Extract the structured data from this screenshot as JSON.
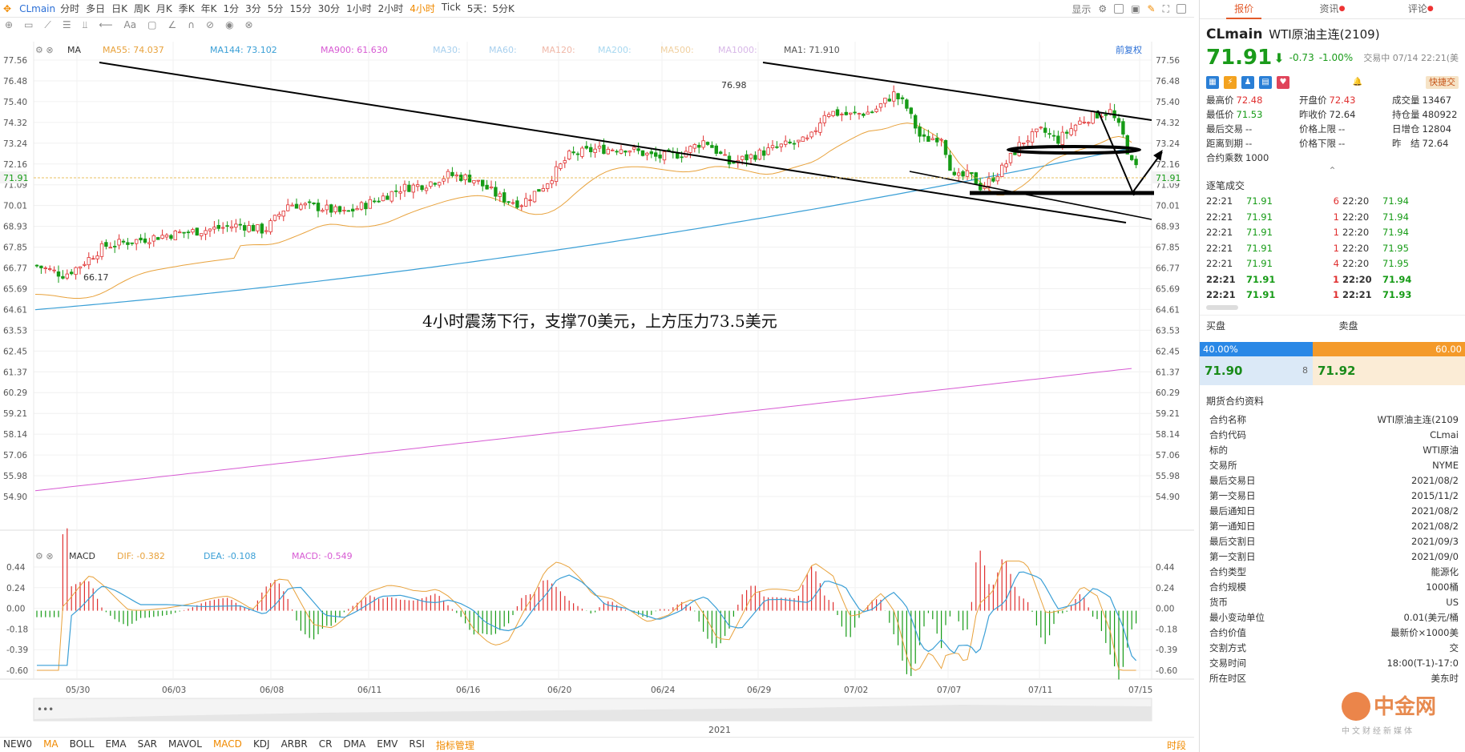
{
  "toolbar": {
    "symbol": "CLmain",
    "periods": [
      "分时",
      "多日",
      "日K",
      "周K",
      "月K",
      "季K",
      "年K",
      "1分",
      "3分",
      "5分",
      "15分",
      "30分",
      "1小时",
      "2小时",
      "4小时",
      "Tick",
      "5天：5分K"
    ],
    "active_period": "4小时",
    "display_label": "显示"
  },
  "indicator_bar": {
    "ma_label": "MA",
    "ma55": "MA55: 74.037",
    "ma144": "MA144: 73.102",
    "ma900": "MA900: 61.630",
    "ma30": "MA30:",
    "ma60": "MA60:",
    "ma120": "MA120:",
    "ma200": "MA200:",
    "ma500": "MA500:",
    "ma1000": "MA1000:",
    "ma1": "MA1: 71.910",
    "restore": "前复权"
  },
  "macd_bar": {
    "label": "MACD",
    "dif": "DIF: -0.382",
    "dea": "DEA: -0.108",
    "macd": "MACD: -0.549"
  },
  "price_axis": [
    "77.56",
    "76.48",
    "75.40",
    "74.32",
    "73.24",
    "72.16",
    "71.09",
    "70.01",
    "68.93",
    "67.85",
    "66.77",
    "65.69",
    "64.61",
    "63.53",
    "62.45",
    "61.37",
    "60.29",
    "59.21",
    "58.14",
    "57.06",
    "55.98",
    "54.90"
  ],
  "macd_axis": [
    "0.44",
    "0.24",
    "0.00",
    "-0.18",
    "-0.39",
    "-0.60"
  ],
  "date_axis": [
    "05/30",
    "06/03",
    "06/08",
    "06/11",
    "06/16",
    "06/20",
    "06/24",
    "06/29",
    "07/02",
    "07/07",
    "07/11",
    "07/15"
  ],
  "high_label": "76.98",
  "low_label": "66.17",
  "current_price": "71.91",
  "annotation": "4小时震荡下行，支撑70美元，上方压力73.5美元",
  "year_label": "2021",
  "bottom_indicators": [
    "NEW0",
    "MA",
    "BOLL",
    "EMA",
    "SAR",
    "MAVOL",
    "MACD",
    "KDJ",
    "ARBR",
    "CR",
    "DMA",
    "EMV",
    "RSI",
    "指标管理"
  ],
  "bottom_right": "时段",
  "colors": {
    "ma55": "#e8a23c",
    "ma144": "#3a9fd6",
    "ma900": "#d75ad3",
    "up": "#e03030",
    "down": "#169b16",
    "accent": "#f08a00"
  },
  "right_panel": {
    "tabs": [
      "报价",
      "资讯",
      "评论"
    ],
    "code": "CLmain",
    "name": "WTI原油主连(2109)",
    "price": "71.91",
    "arrow": "⬇",
    "change": "-0.73",
    "change_pct": "-1.00%",
    "time": "交易中 07/14 22:21(美",
    "fast_trade": "快捷交",
    "stats": [
      [
        "最高价",
        "72.48",
        "red"
      ],
      [
        "开盘价",
        "72.43",
        "red"
      ],
      [
        "成交量",
        "13467",
        ""
      ],
      [
        "最低价",
        "71.53",
        "grn"
      ],
      [
        "昨收价",
        "72.64",
        ""
      ],
      [
        "持仓量",
        "480922",
        ""
      ],
      [
        "最后交易",
        "--",
        ""
      ],
      [
        "价格上限",
        "--",
        ""
      ],
      [
        "日增仓",
        "12804",
        ""
      ],
      [
        "距离到期",
        "--",
        ""
      ],
      [
        "价格下限",
        "--",
        ""
      ],
      [
        "昨　结",
        "72.64",
        ""
      ],
      [
        "合约乘数",
        "1000",
        ""
      ]
    ],
    "trades_title": "逐笔成交",
    "trades": [
      [
        "22:21",
        "71.91",
        "6",
        "22:20",
        "71.94"
      ],
      [
        "22:21",
        "71.91",
        "1",
        "22:20",
        "71.94"
      ],
      [
        "22:21",
        "71.91",
        "1",
        "22:20",
        "71.94"
      ],
      [
        "22:21",
        "71.91",
        "1",
        "22:20",
        "71.95"
      ],
      [
        "22:21",
        "71.91",
        "4",
        "22:20",
        "71.95"
      ],
      [
        "22:21",
        "71.91",
        "1",
        "22:20",
        "71.94"
      ],
      [
        "22:21",
        "71.91",
        "1",
        "22:21",
        "71.93"
      ]
    ],
    "buy_label": "买盘",
    "sell_label": "卖盘",
    "buy_pct": "40.00%",
    "sell_pct": "60.00",
    "bid": "71.90",
    "bid_size": "8",
    "ask": "71.92",
    "info_title": "期货合约资料",
    "info": [
      [
        "合约名称",
        "WTI原油主连(2109"
      ],
      [
        "合约代码",
        "CLmai"
      ],
      [
        "标的",
        "WTI原油"
      ],
      [
        "交易所",
        "NYME"
      ],
      [
        "最后交易日",
        "2021/08/2"
      ],
      [
        "第一交易日",
        "2015/11/2"
      ],
      [
        "最后通知日",
        "2021/08/2"
      ],
      [
        "第一通知日",
        "2021/08/2"
      ],
      [
        "最后交割日",
        "2021/09/3"
      ],
      [
        "第一交割日",
        "2021/09/0"
      ],
      [
        "合约类型",
        "能源化"
      ],
      [
        "合约规模",
        "1000桶"
      ],
      [
        "货币",
        "US"
      ],
      [
        "最小变动单位",
        "0.01(美元/桶"
      ],
      [
        "合约价值",
        "最新价×1000美"
      ],
      [
        "交割方式",
        "交"
      ],
      [
        "交易时间",
        "18:00(T-1)-17:0"
      ],
      [
        "所在时区",
        "美东时"
      ]
    ]
  },
  "watermark": {
    "name": "中金网",
    "sub": "中文财经新媒体"
  }
}
